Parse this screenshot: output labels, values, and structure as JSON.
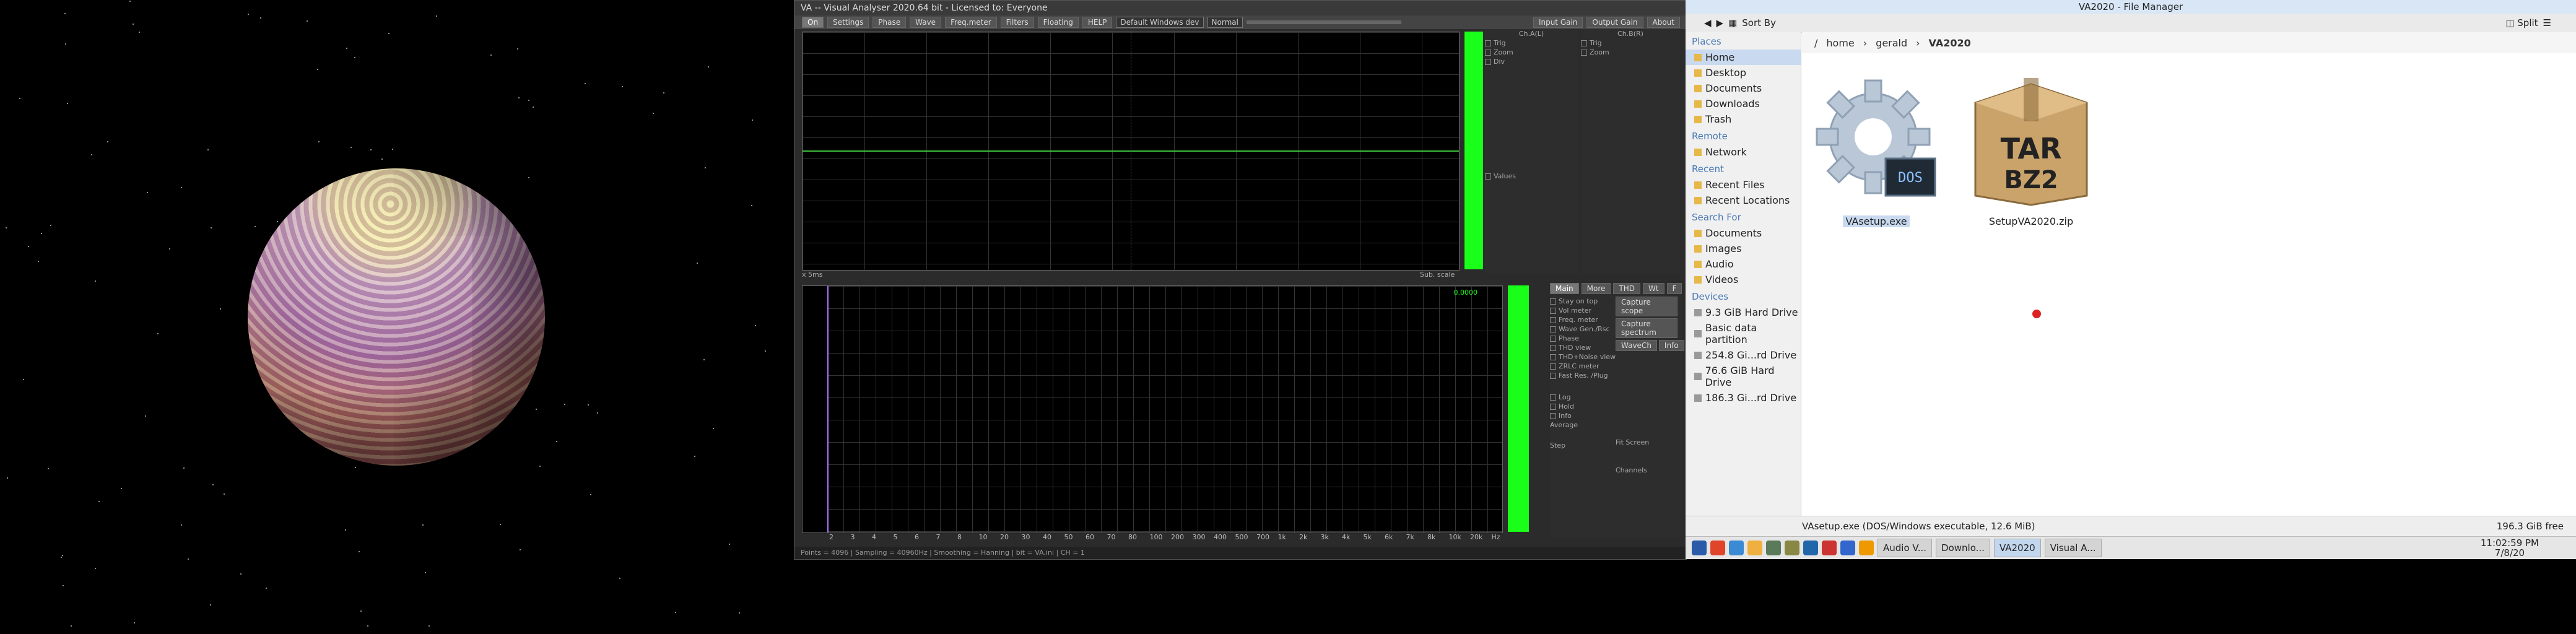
{
  "va": {
    "title": "VA -- Visual Analyser 2020.64 bit - Licensed to: Everyone",
    "menu": [
      "On",
      "Settings",
      "Phase",
      "Wave",
      "Freq.meter",
      "Filters",
      "Floating",
      "HELP"
    ],
    "device": "Default Windows dev",
    "mode": "Normal",
    "input_gain": "Input Gain",
    "output_gain": "Output Gain",
    "about": "About",
    "scope_labels": {
      "ch_a": "Ch.A(L)",
      "ch_b": "Ch.B(R)",
      "trig": "Trig",
      "zoom": "Zoom",
      "div": "Div",
      "values": "Values"
    },
    "scope_scale": "Sub. scale",
    "scope_status_left": "x 5ms",
    "spectrum_tabs": [
      "Main",
      "More",
      "THD",
      "Wt",
      "F"
    ],
    "spectrum_options": [
      "Stay on top",
      "Vol meter",
      "Freq. meter",
      "Wave Gen./Rsc",
      "Phase",
      "THD view",
      "THD+Noise view",
      "ZRLC meter",
      "Fast Res. /Plug"
    ],
    "spectrum_buttons": [
      "Capture scope",
      "Capture spectrum",
      "WaveCh",
      "Info"
    ],
    "spectrum_fields": [
      "Log",
      "Hold",
      "Info",
      "Average",
      "Step",
      "Fit Screen",
      "Channels"
    ],
    "spectrum_value": "0.0000",
    "x_ticks": [
      "2",
      "3",
      "4",
      "5",
      "6",
      "7",
      "8",
      "10",
      "20",
      "30",
      "40",
      "50",
      "60",
      "70",
      "80",
      "100",
      "200",
      "300",
      "400",
      "500",
      "700",
      "1k",
      "2k",
      "3k",
      "4k",
      "5k",
      "6k",
      "7k",
      "8k",
      "10k",
      "20k",
      "Hz"
    ],
    "status": "Points = 4096 | Sampling = 40960Hz | Smoothing = Hanning | bit = VA.ini | CH = 1"
  },
  "fm": {
    "title": "VA2020 - File Manager",
    "sort_label": "Sort By",
    "split_label": "Split",
    "breadcrumb": [
      "/",
      "home",
      "gerald",
      "VA2020"
    ],
    "sections": [
      {
        "header": "Places",
        "items": [
          "Home",
          "Desktop",
          "Documents",
          "Downloads",
          "Trash"
        ]
      },
      {
        "header": "Remote",
        "items": [
          "Network"
        ]
      },
      {
        "header": "Recent",
        "items": [
          "Recent Files",
          "Recent Locations"
        ]
      },
      {
        "header": "Search For",
        "items": [
          "Documents",
          "Images",
          "Audio",
          "Videos"
        ]
      },
      {
        "header": "Devices",
        "items": [
          "9.3 GiB Hard Drive",
          "Basic data partition",
          "254.8 Gi...rd Drive",
          "76.6 GiB Hard Drive",
          "186.3 Gi...rd Drive"
        ]
      }
    ],
    "files": [
      {
        "name": "VAsetup.exe",
        "icon": "exe-gear-icon"
      },
      {
        "name": "SetupVA2020.zip",
        "icon": "tar-bz2-archive-icon",
        "badge": "TAR BZ2"
      }
    ],
    "status": "VAsetup.exe (DOS/Windows executable, 12.6 MiB)",
    "free": "196.3 GiB free",
    "exe_badge": "DOS"
  },
  "taskbar": {
    "tasks": [
      "Audio V...",
      "Downlo...",
      "VA2020",
      "Visual A..."
    ],
    "time": "11:02:59 PM",
    "date": "7/8/20"
  },
  "colors": {
    "meter": "#19ff19",
    "trace": "#3cbf3c",
    "spectrum_line": "#b070ff"
  }
}
